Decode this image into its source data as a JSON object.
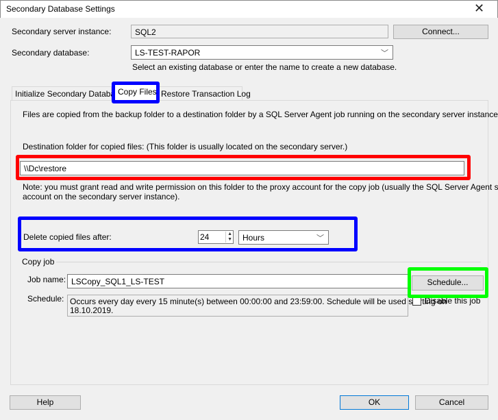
{
  "window": {
    "title": "Secondary Database Settings",
    "close_icon": "close-icon"
  },
  "server": {
    "label": "Secondary server instance:",
    "value": "SQL2",
    "connect_label": "Connect..."
  },
  "database": {
    "label": "Secondary database:",
    "value": "LS-TEST-RAPOR",
    "hint": "Select an existing database or enter the name to create a new database."
  },
  "tabs": [
    {
      "label": "Initialize Secondary Database"
    },
    {
      "label": "Copy Files",
      "selected": true
    },
    {
      "label": "Restore Transaction Log"
    }
  ],
  "copy_files": {
    "description": "Files are copied from the backup folder to a destination folder by a SQL Server Agent job running on the secondary server instance.",
    "dest_label": "Destination folder for copied files: (This folder is usually located on the secondary server.)",
    "dest_value": "\\\\Dc\\restore",
    "note_line1": "Note: you must grant read and write permission on this folder to the proxy account for the copy job (usually the SQL Server Agent service",
    "note_line2": "account on the secondary server instance).",
    "delete_label": "Delete copied files after:",
    "delete_value": "24",
    "delete_unit": "Hours",
    "copy_job_label": "Copy job",
    "job_name_label": "Job name:",
    "job_name_value": "LSCopy_SQL1_LS-TEST",
    "schedule_button": "Schedule...",
    "schedule_label": "Schedule:",
    "schedule_line1": "Occurs every day every 15 minute(s) between 00:00:00 and 23:59:00. Schedule will be used starting on",
    "schedule_line2": "18.10.2019.",
    "disable_label": "Disable this job",
    "disable_checked": false
  },
  "footer": {
    "help": "Help",
    "ok": "OK",
    "cancel": "Cancel"
  },
  "highlights": {
    "blue": "#0000ff",
    "red": "#ff0000",
    "green": "#00ff00"
  }
}
